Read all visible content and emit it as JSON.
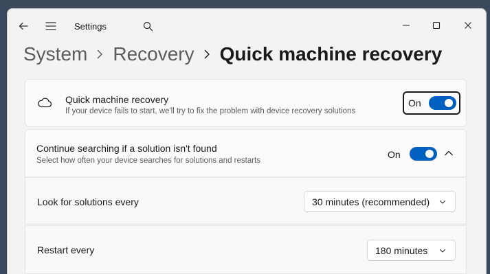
{
  "window": {
    "app_title": "Settings"
  },
  "breadcrumb": {
    "items": [
      "System",
      "Recovery"
    ],
    "current": "Quick machine recovery"
  },
  "quick_recovery": {
    "title": "Quick machine recovery",
    "description": "If your device fails to start, we'll try to fix the problem with device recovery solutions",
    "toggle_label": "On",
    "toggle_on": true,
    "icon": "cloud-icon"
  },
  "continue_searching": {
    "title": "Continue searching if a solution isn't found",
    "description": "Select how often your device searches for solutions and restarts",
    "toggle_label": "On",
    "toggle_on": true,
    "expanded": true
  },
  "look_for_solutions": {
    "label": "Look for solutions every",
    "selected": "30 minutes (recommended)"
  },
  "restart_every": {
    "label": "Restart every",
    "selected": "180 minutes"
  },
  "colors": {
    "accent": "#0060c0",
    "background": "#f3f3f3",
    "card": "#fbfbfb"
  }
}
